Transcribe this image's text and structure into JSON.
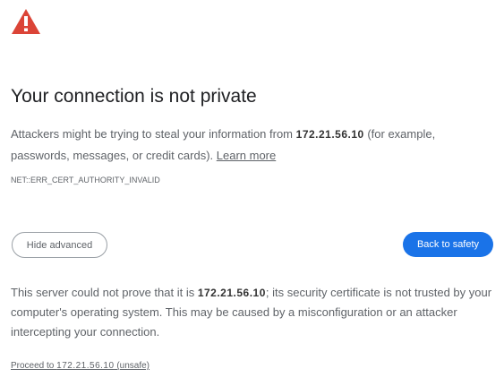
{
  "icon": "warning-triangle-icon",
  "colors": {
    "icon_red": "#db4437",
    "primary_button": "#1a73e8",
    "text": "#5f6368",
    "title": "#202124"
  },
  "title": "Your connection is not private",
  "main_message": {
    "prefix": "Attackers might be trying to steal your information from ",
    "host": "172.21.56.10",
    "suffix": " (for example, passwords, messages, or credit cards). ",
    "learn_more": "Learn more"
  },
  "error_code": "NET::ERR_CERT_AUTHORITY_INVALID",
  "buttons": {
    "hide_advanced": "Hide advanced",
    "back_to_safety": "Back to safety"
  },
  "details": {
    "prefix": "This server could not prove that it is ",
    "host": "172.21.56.10",
    "suffix": "; its security certificate is not trusted by your computer's operating system. This may be caused by a misconfiguration or an attacker intercepting your connection."
  },
  "proceed": {
    "prefix": "Proceed to ",
    "host": "172.21.56.10",
    "suffix": " (unsafe)"
  }
}
